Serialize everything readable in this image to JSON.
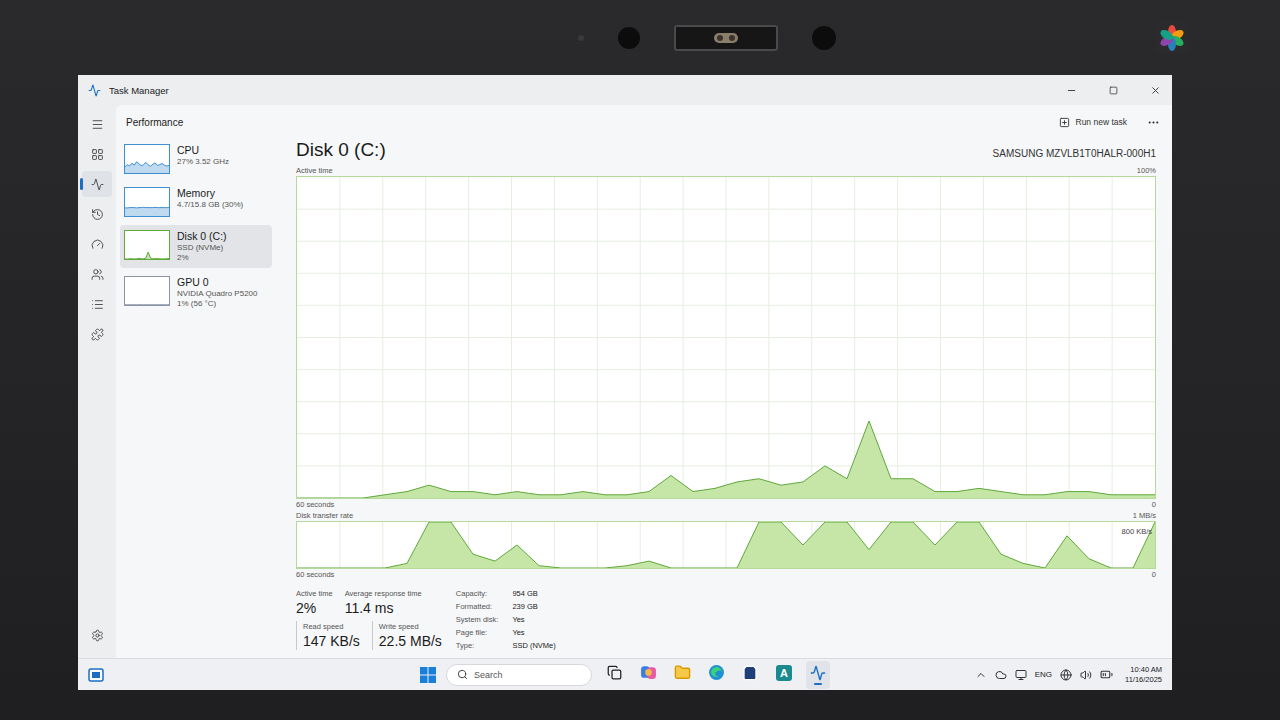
{
  "window": {
    "title": "Task Manager"
  },
  "nav": [
    {
      "kind": "menu",
      "selected": false
    },
    {
      "kind": "processes",
      "selected": false
    },
    {
      "kind": "performance",
      "selected": true
    },
    {
      "kind": "history",
      "selected": false
    },
    {
      "kind": "startup",
      "selected": false
    },
    {
      "kind": "users",
      "selected": false
    },
    {
      "kind": "details",
      "selected": false
    },
    {
      "kind": "services",
      "selected": false
    },
    {
      "kind": "settings",
      "selected": false
    }
  ],
  "header": {
    "title": "Performance",
    "action": "Run new task"
  },
  "resources": [
    {
      "name": "CPU",
      "lines": [
        "27% 3.52 GHz"
      ],
      "selected": false,
      "color": "#3e8ed0",
      "graph": [
        22,
        30,
        25,
        35,
        28,
        40,
        33,
        26,
        30,
        38,
        29,
        24,
        31,
        36,
        27,
        30,
        34,
        28,
        25,
        27
      ]
    },
    {
      "name": "Memory",
      "lines": [
        "4.7/15.8 GB (30%)"
      ],
      "selected": false,
      "color": "#3e8ed0",
      "graph": [
        29,
        29,
        30,
        30,
        30,
        29,
        30,
        30,
        31,
        30,
        30,
        30,
        30,
        31,
        30,
        30,
        30,
        30,
        30,
        30
      ]
    },
    {
      "name": "Disk 0 (C:)",
      "lines": [
        "SSD (NVMe)",
        "2%"
      ],
      "selected": true,
      "color": "#5fa83a",
      "graph": [
        0,
        0,
        1,
        1,
        0,
        1,
        2,
        1,
        1,
        3,
        25,
        4,
        1,
        1,
        2,
        1,
        0,
        1,
        1,
        2
      ]
    },
    {
      "name": "GPU 0",
      "lines": [
        "NVIDIA Quadro P5200",
        "1% (56 °C)"
      ],
      "selected": false,
      "color": "#8a94a6",
      "graph": [
        1,
        1,
        1,
        1,
        1,
        1,
        1,
        1,
        1,
        1,
        1,
        1,
        1,
        1,
        1,
        1,
        1,
        1,
        1,
        1
      ]
    }
  ],
  "detail": {
    "title": "Disk 0 (C:)",
    "model": "SAMSUNG MZVLB1T0HALR-000H1",
    "active_chart": {
      "label": "Active time",
      "max_label": "100%",
      "max": 100,
      "span": "60 seconds",
      "min_label": "0",
      "values": [
        0,
        0,
        0,
        0,
        1,
        2,
        4,
        2,
        2,
        1,
        2,
        1,
        1,
        2,
        1,
        1,
        2,
        7,
        2,
        3,
        5,
        6,
        4,
        5,
        10,
        6,
        24,
        6,
        6,
        2,
        2,
        3,
        2,
        1,
        1,
        2,
        2,
        1,
        1,
        1
      ]
    },
    "transfer_chart": {
      "label": "Disk transfer rate",
      "max_label": "1 MB/s",
      "max": 1000,
      "mid_label": "800 KB/s",
      "mid": 800,
      "span": "60 seconds",
      "min_label": "0",
      "values": [
        0,
        0,
        0,
        0,
        0,
        100,
        1000,
        1000,
        300,
        150,
        500,
        50,
        0,
        0,
        0,
        50,
        150,
        0,
        0,
        0,
        0,
        1000,
        1000,
        500,
        1000,
        1000,
        400,
        1000,
        1000,
        500,
        1000,
        1000,
        300,
        100,
        0,
        700,
        200,
        0,
        0,
        1000
      ]
    },
    "stats": [
      {
        "label": "Active time",
        "value": "2%"
      },
      {
        "label": "Average response time",
        "value": "11.4 ms"
      }
    ],
    "speeds": [
      {
        "label": "Read speed",
        "value": "147 KB/s"
      },
      {
        "label": "Write speed",
        "value": "22.5 MB/s"
      }
    ],
    "properties": [
      {
        "label": "Capacity:",
        "value": "954 GB"
      },
      {
        "label": "Formatted:",
        "value": "239 GB"
      },
      {
        "label": "System disk:",
        "value": "Yes"
      },
      {
        "label": "Page file:",
        "value": "Yes"
      },
      {
        "label": "Type:",
        "value": "SSD (NVMe)"
      }
    ]
  },
  "taskbar": {
    "search": "Search",
    "apps": [
      {
        "kind": "taskview",
        "label": "",
        "selected": false
      },
      {
        "kind": "copilot",
        "label": "",
        "selected": false
      },
      {
        "kind": "explorer",
        "label": "",
        "selected": false
      },
      {
        "kind": "edge",
        "label": "",
        "selected": false
      },
      {
        "kind": "store",
        "label": "",
        "selected": false
      },
      {
        "kind": "letter",
        "label": "A",
        "selected": false
      },
      {
        "kind": "taskmanager",
        "label": "",
        "selected": true
      }
    ],
    "language": "ENG",
    "time": "10:40 AM",
    "date": "11/16/2025"
  }
}
